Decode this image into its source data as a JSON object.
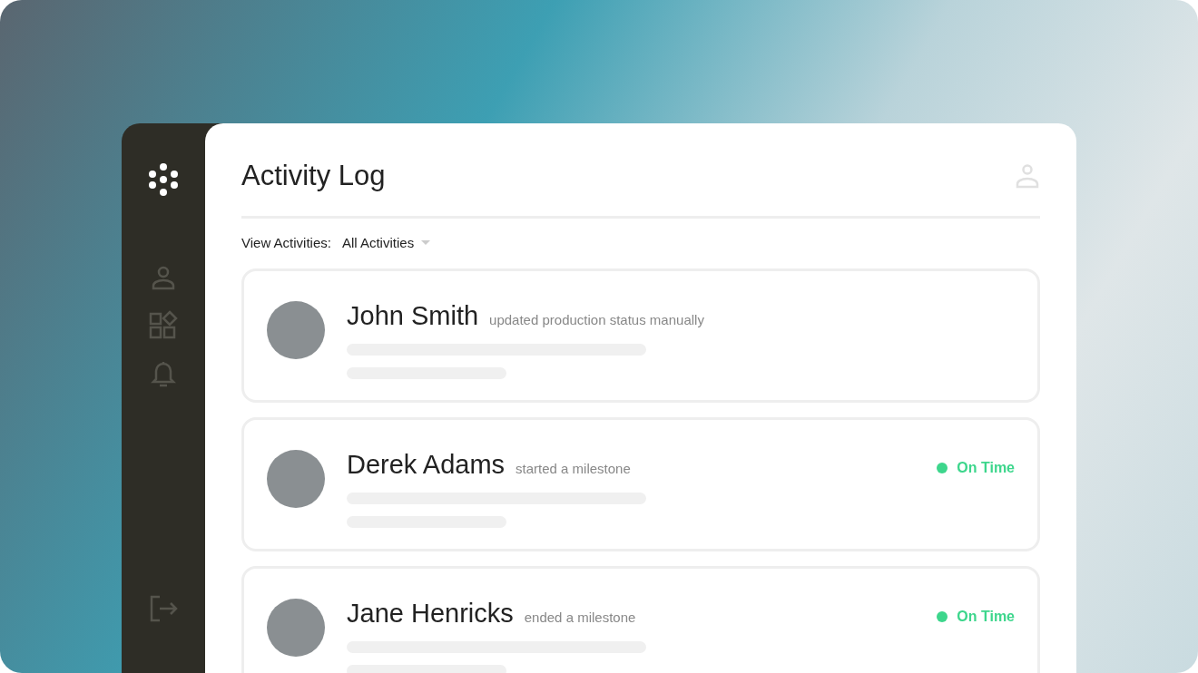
{
  "header": {
    "title": "Activity Log"
  },
  "filter": {
    "label": "View Activities:",
    "value": "All Activities"
  },
  "activities": [
    {
      "name": "John Smith",
      "action": "updated production status manually"
    },
    {
      "name": "Derek Adams",
      "action": "started a milestone",
      "status": {
        "label": "On Time",
        "color": "#3dd68c"
      }
    },
    {
      "name": "Jane Henricks",
      "action": "ended a milestone",
      "status": {
        "label": "On Time",
        "color": "#3dd68c"
      }
    }
  ]
}
